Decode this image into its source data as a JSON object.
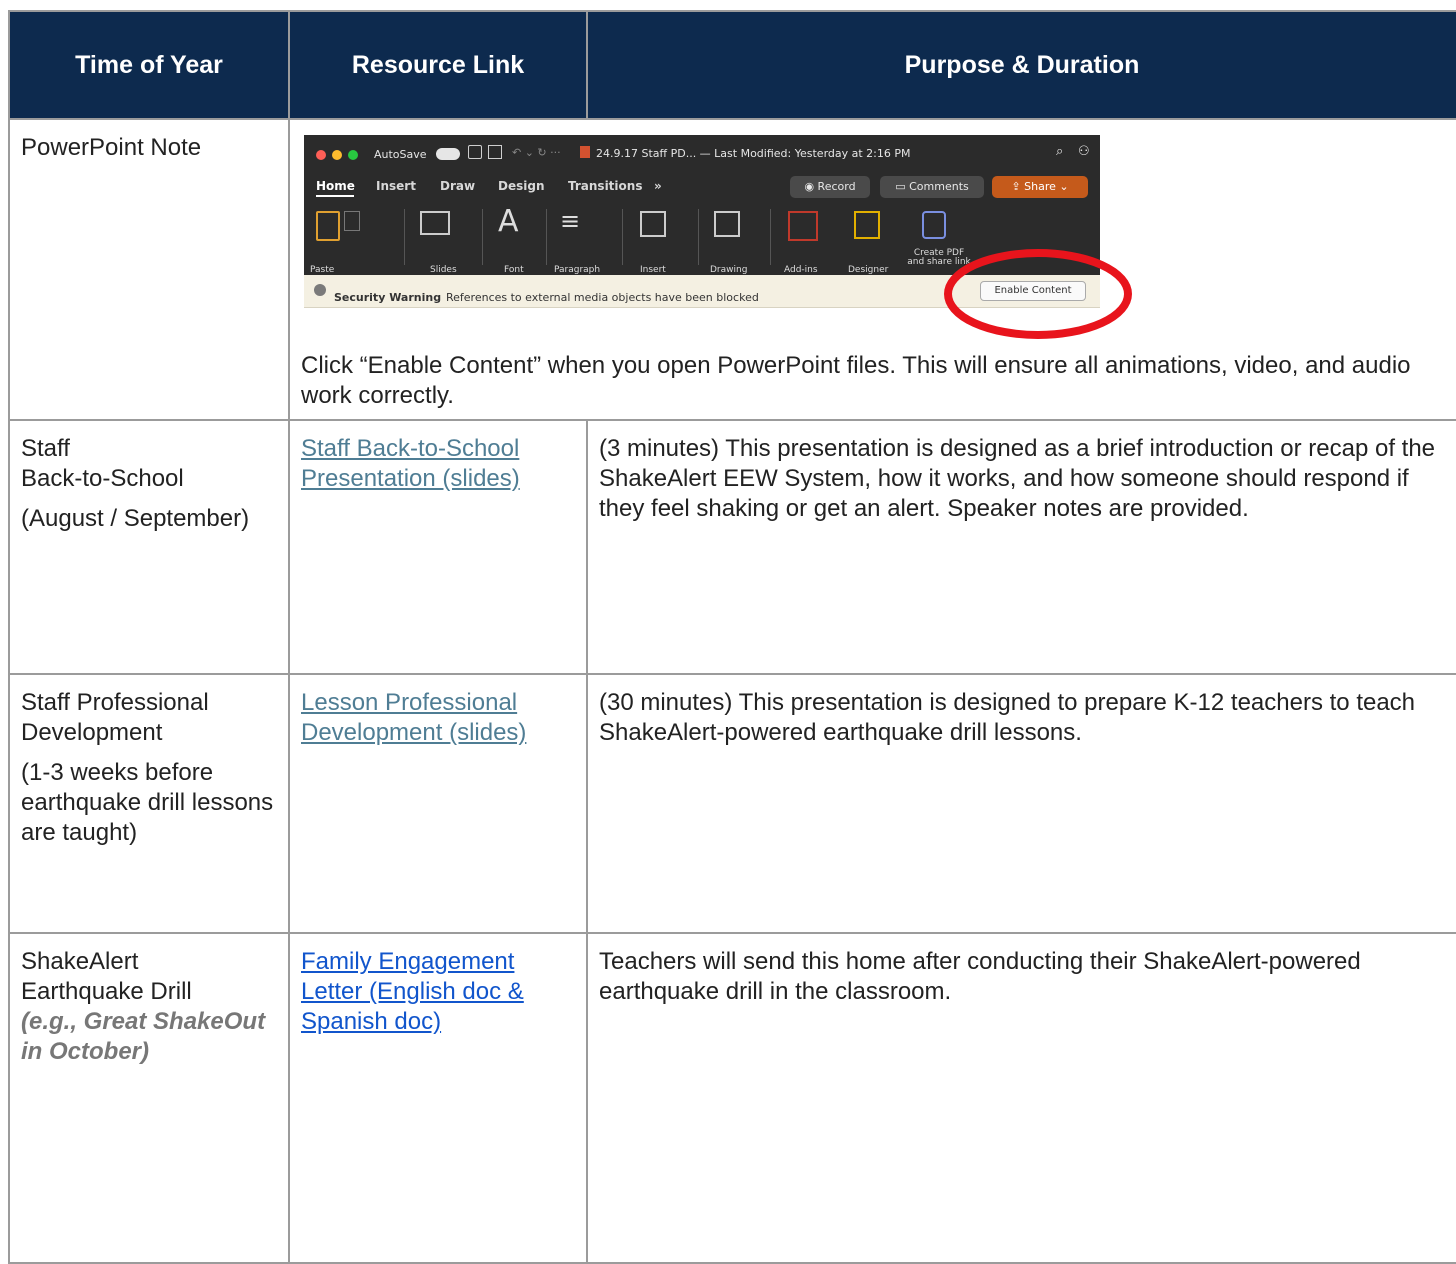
{
  "table": {
    "headers": [
      "Time of Year",
      "Resource Link",
      "Purpose & Duration"
    ],
    "ppt_note": {
      "label": "PowerPoint Note",
      "text": "Click “Enable Content” when you open PowerPoint files. This will ensure all animations, video, and audio work correctly.",
      "screenshot": {
        "autosave": "AutoSave",
        "file_title": "24.9.17 Staff PD... — Last Modified: Yesterday at 2:16 PM",
        "tabs": [
          "Home",
          "Insert",
          "Draw",
          "Design",
          "Transitions",
          "»"
        ],
        "record": "Record",
        "comments": "Comments",
        "share": "Share",
        "groups": [
          "Paste",
          "Slides",
          "Font",
          "Paragraph",
          "Insert",
          "Drawing",
          "Add-ins",
          "Designer",
          "Create PDF and share link"
        ],
        "warning_title": "Security Warning",
        "warning_text": "References to external media objects have been blocked",
        "enable_button": "Enable Content",
        "highlight_color": "#e8141c"
      }
    },
    "rows": [
      {
        "time_lines": [
          "Staff",
          "Back-to-School"
        ],
        "time_note": "(August / September)",
        "link": "Staff Back-to-School Presentation (slides)",
        "purpose": "(3 minutes) This presentation is designed as a brief introduction or recap of the ShakeAlert EEW System, how it works, and how someone should respond if they feel shaking or get an alert. Speaker notes are provided."
      },
      {
        "time_lines": [
          "Staff Professional",
          "Development"
        ],
        "time_note": "(1-3 weeks before earthquake drill lessons are taught)",
        "link": "Lesson Professional Development (slides)",
        "purpose": "(30 minutes) This presentation is designed to prepare K-12 teachers to teach ShakeAlert-powered earthquake drill lessons."
      },
      {
        "time_lines": [
          "ShakeAlert",
          "Earthquake Drill"
        ],
        "time_note": "(e.g., Great ShakeOut in October)",
        "link": "Family Engagement Letter (English doc & Spanish doc)",
        "purpose": "Teachers will send this home after conducting their ShakeAlert-powered earthquake drill in the classroom."
      }
    ]
  }
}
